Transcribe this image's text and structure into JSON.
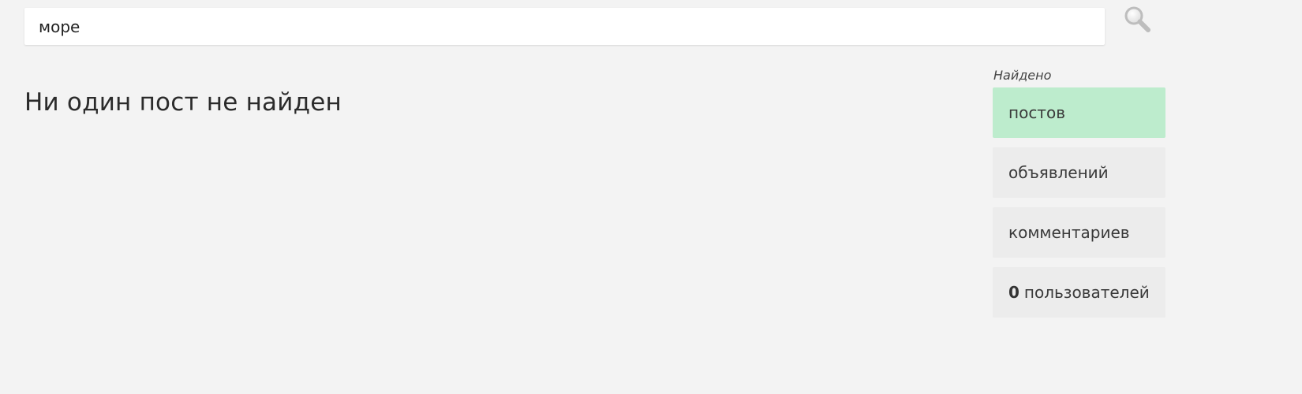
{
  "search": {
    "value": "море",
    "icon": "magnifier-icon"
  },
  "main": {
    "empty_message": "Ни один пост не найден"
  },
  "results_panel": {
    "heading": "Найдено",
    "active_color": "#bdeccd",
    "items": [
      {
        "count": "",
        "label": "постов",
        "active": true
      },
      {
        "count": "",
        "label": "объявлений",
        "active": false
      },
      {
        "count": "",
        "label": "комментариев",
        "active": false
      },
      {
        "count": "0",
        "label": "пользователей",
        "active": false
      }
    ]
  }
}
